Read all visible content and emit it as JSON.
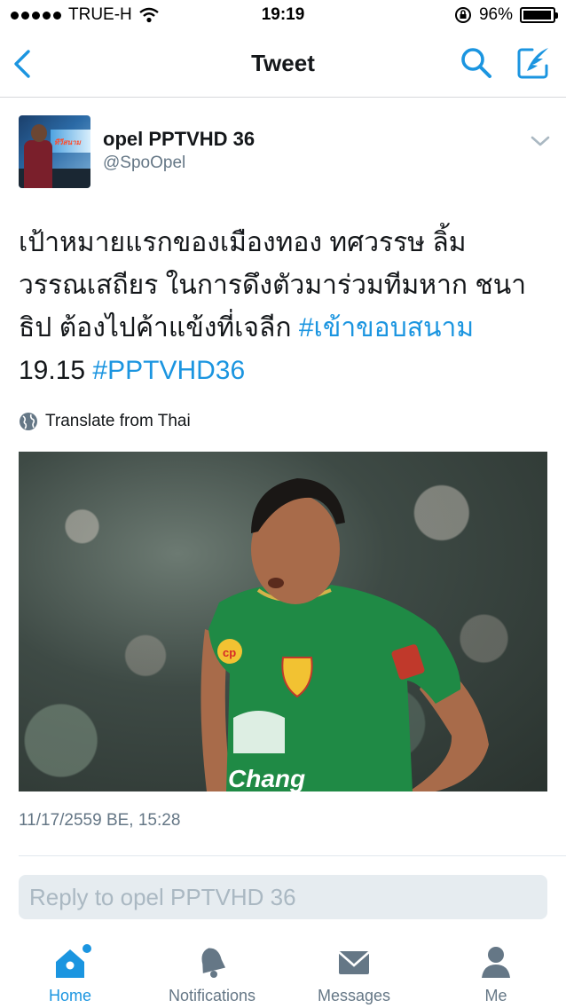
{
  "status_bar": {
    "carrier": "TRUE-H",
    "time": "19:19",
    "battery_percent": "96%",
    "battery_level": 0.96,
    "icons": [
      "signal-dots-icon",
      "wifi-icon",
      "orientation-lock-icon",
      "battery-icon"
    ]
  },
  "nav": {
    "title": "Tweet",
    "icons": [
      "back-chevron-icon",
      "search-icon",
      "compose-icon"
    ]
  },
  "tweet": {
    "author_name": "opel PPTVHD 36",
    "author_handle": "@SpoOpel",
    "avatar_overlay_text": "ทีวีสนาม",
    "text_lines": [
      "เป้าหมายแรกของเมืองทอง ทศวรรษ ลิ้ม",
      "วรรณเสถียร ในการดึงตัวมาร่วมทีมหาก ชนา",
      "ธิป ต้องไปค้าแข้งที่เจลีก "
    ],
    "hashtag_1": "#เข้าขอบสนาม",
    "line4_prefix": "19.15 ",
    "hashtag_2": "#PPTVHD36",
    "translate_label": "Translate from Thai",
    "timestamp": "11/17/2559 BE, 15:28",
    "photo_jersey_text": "Chang"
  },
  "reply": {
    "placeholder": "Reply to opel PPTVHD 36"
  },
  "tab_bar": {
    "tabs": [
      {
        "label": "Home",
        "icon": "home-icon",
        "active": true
      },
      {
        "label": "Notifications",
        "icon": "bell-icon",
        "active": false
      },
      {
        "label": "Messages",
        "icon": "envelope-icon",
        "active": false
      },
      {
        "label": "Me",
        "icon": "person-icon",
        "active": false
      }
    ]
  },
  "colors": {
    "accent": "#1b95e0",
    "text": "#14171a",
    "secondary_text": "#657786",
    "reply_background": "#e6ecf0"
  }
}
